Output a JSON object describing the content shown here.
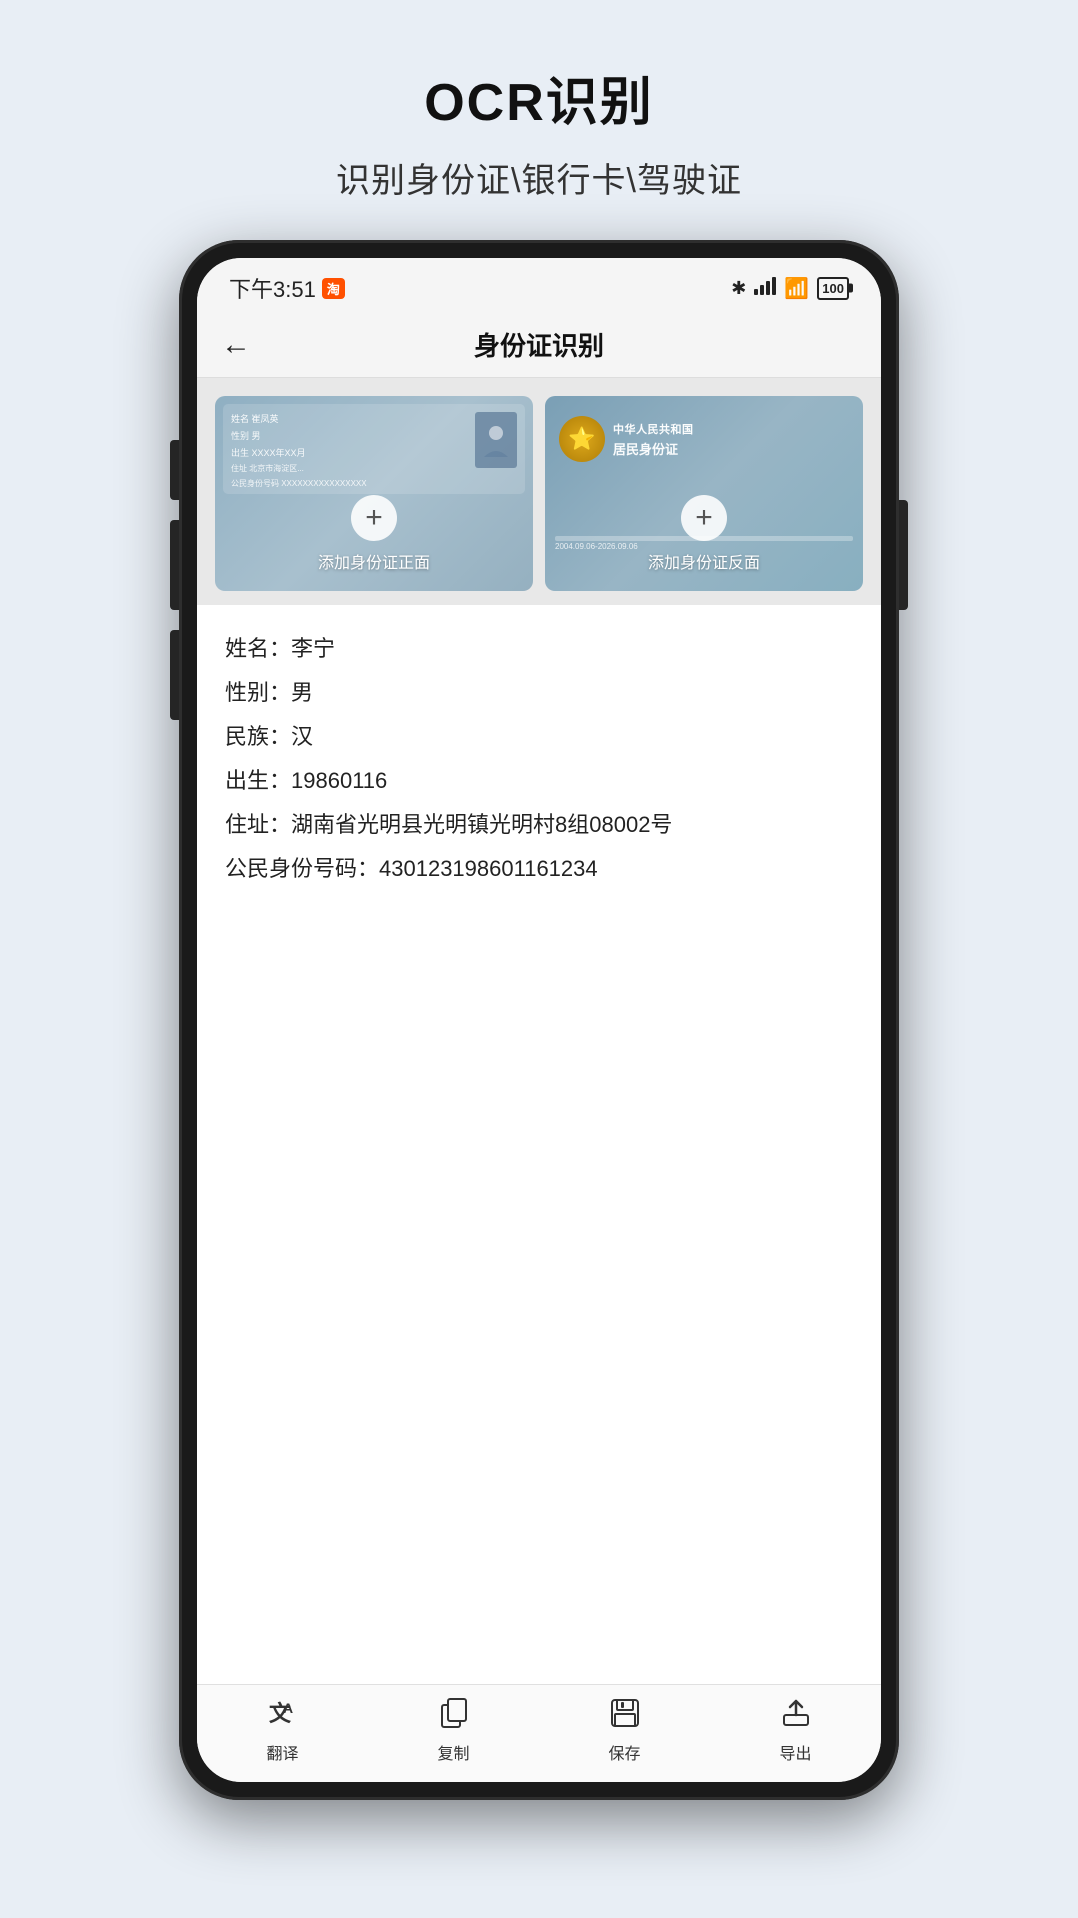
{
  "page": {
    "title": "OCR识别",
    "subtitle": "识别身份证\\银行卡\\驾驶证"
  },
  "status_bar": {
    "time": "下午3:51",
    "taobao_badge": "淘",
    "battery": "100"
  },
  "nav": {
    "back_label": "←",
    "title": "身份证识别"
  },
  "card_front": {
    "add_label": "添加身份证正面"
  },
  "card_back": {
    "title": "中华人民共和国",
    "subtitle": "居民身份证",
    "add_label": "添加身份证反面",
    "date": "2004.09.06-2026.09.06"
  },
  "ocr_result": {
    "name_label": "姓名：",
    "name_value": "李宁",
    "gender_label": "性别：",
    "gender_value": "男",
    "ethnicity_label": "民族：",
    "ethnicity_value": "汉",
    "birth_label": "出生：",
    "birth_value": "19860116",
    "address_label": "住址：",
    "address_value": "湖南省光明县光明镇光明村8组08002号",
    "id_label": "公民身份号码：",
    "id_value": "430123198601161234"
  },
  "bottom_nav": {
    "translate_icon": "译",
    "translate_label": "翻译",
    "copy_icon": "📋",
    "copy_label": "复制",
    "save_icon": "💾",
    "save_label": "保存",
    "export_icon": "⬆",
    "export_label": "导出"
  }
}
